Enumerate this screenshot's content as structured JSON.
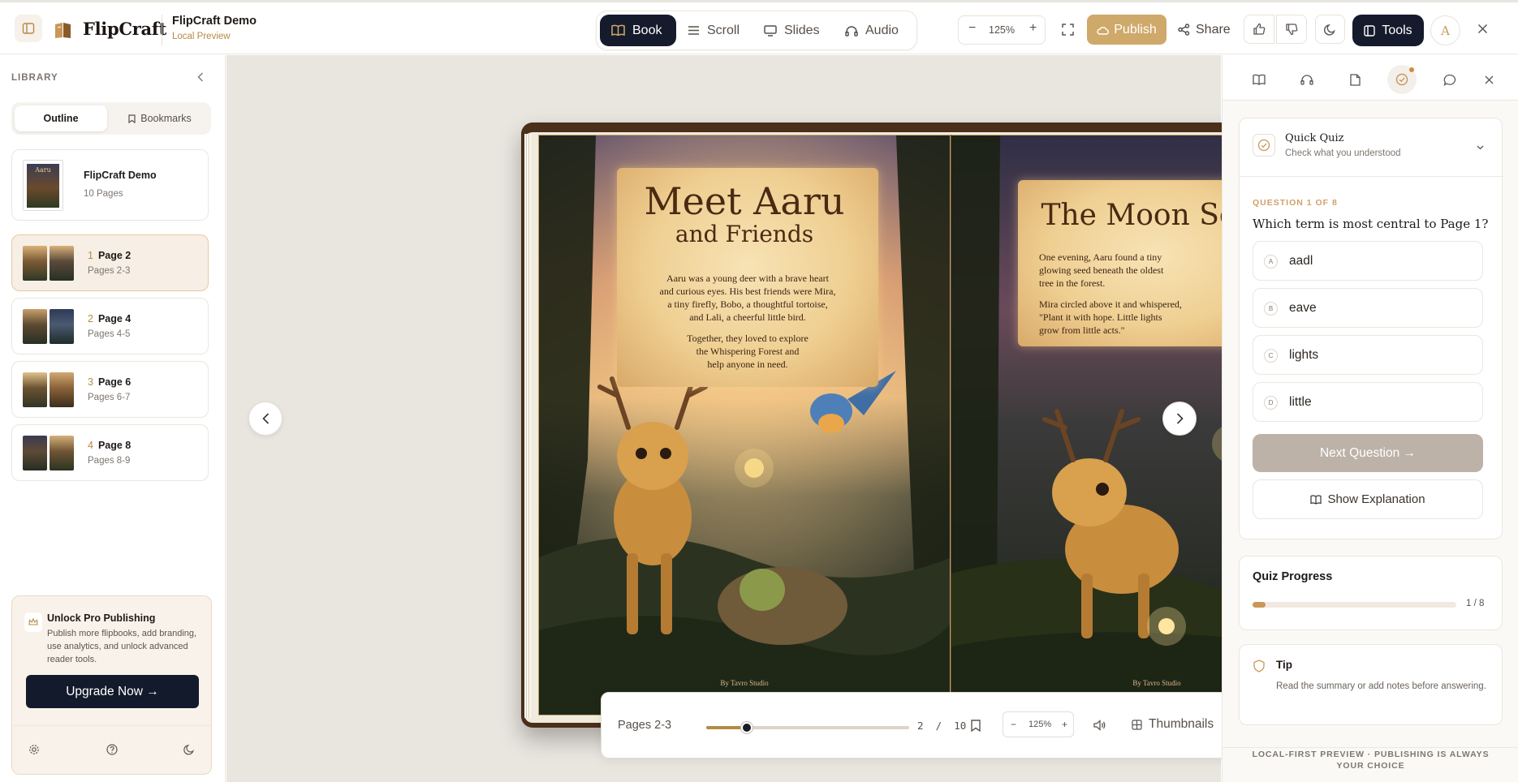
{
  "header": {
    "brand": "FlipCraft",
    "doc_title": "FlipCraft Demo",
    "doc_subtitle": "Local Preview",
    "modes": [
      {
        "label": "Book",
        "icon": "book-icon",
        "active": true
      },
      {
        "label": "Scroll",
        "icon": "list-icon",
        "active": false
      },
      {
        "label": "Slides",
        "icon": "monitor-icon",
        "active": false
      },
      {
        "label": "Audio",
        "icon": "headphones-icon",
        "active": false
      }
    ],
    "zoom": "125%",
    "publish_label": "Publish",
    "share_label": "Share",
    "tools_label": "Tools",
    "avatar_initial": "A"
  },
  "sidebar": {
    "title": "LIBRARY",
    "tabs": [
      {
        "label": "Outline",
        "active": true
      },
      {
        "label": "Bookmarks",
        "active": false
      }
    ],
    "book": {
      "title": "FlipCraft Demo",
      "pages": "10 Pages",
      "cover_text": "Aaru"
    },
    "outline": [
      {
        "num": "1",
        "title": "Page 2",
        "sub": "Pages 2-3",
        "selected": true
      },
      {
        "num": "2",
        "title": "Page 4",
        "sub": "Pages 4-5",
        "selected": false
      },
      {
        "num": "3",
        "title": "Page 6",
        "sub": "Pages 6-7",
        "selected": false
      },
      {
        "num": "4",
        "title": "Page 8",
        "sub": "Pages 8-9",
        "selected": false
      }
    ],
    "promo": {
      "title": "Unlock Pro Publishing",
      "text": "Publish more flipbooks, add branding, use analytics, and unlock advanced reader tools.",
      "button": "Upgrade Now →"
    }
  },
  "book": {
    "left_page": {
      "title_line1": "Meet Aaru",
      "title_line2": "and Friends",
      "para1": [
        "Aaru was a young deer with a brave heart",
        "and curious eyes. His best friends were Mira,",
        "a tiny firefly, Bobo, a thoughtful tortoise,",
        "and Lali, a cheerful little bird."
      ],
      "para2": [
        "Together, they loved to explore",
        "the Whispering Forest and",
        "help anyone in need."
      ],
      "studio": "By Tavro Studio"
    },
    "right_page": {
      "title": "The Moon Seed",
      "para1": [
        "One evening, Aaru found a tiny",
        "glowing seed beneath the oldest",
        "tree in the forest."
      ],
      "para2": [
        "Mira circled above it and whispered,",
        "\"Plant it with hope. Little lights",
        "grow from little acts.\""
      ],
      "studio": "By Tavro Studio"
    }
  },
  "controls": {
    "pages_label": "Pages 2-3",
    "current_page": "2",
    "separator": "/",
    "total_pages": "10",
    "slider_fraction": 0.2,
    "zoom": "125%",
    "thumbnails_label": "Thumbnails"
  },
  "quiz": {
    "title": "Quick Quiz",
    "subtitle": "Check what you understood",
    "question_num": "QUESTION 1 OF 8",
    "question": "Which term is most central to Page 1?",
    "options": [
      {
        "letter": "A",
        "text": "aadl"
      },
      {
        "letter": "B",
        "text": "eave"
      },
      {
        "letter": "C",
        "text": "lights"
      },
      {
        "letter": "D",
        "text": "little"
      }
    ],
    "next_label": "Next Question →",
    "explain_label": "Show Explanation"
  },
  "progress": {
    "title": "Quiz Progress",
    "value": "1 / 8",
    "fraction": 0.0625
  },
  "tip": {
    "title": "Tip",
    "text": "Read the summary or add notes before answering."
  },
  "footer_note": "LOCAL-FIRST PREVIEW · PUBLISHING IS ALWAYS YOUR CHOICE",
  "colors": {
    "accent": "#cfa96a",
    "dark": "#151b2c",
    "gold_text": "#b58a45"
  }
}
